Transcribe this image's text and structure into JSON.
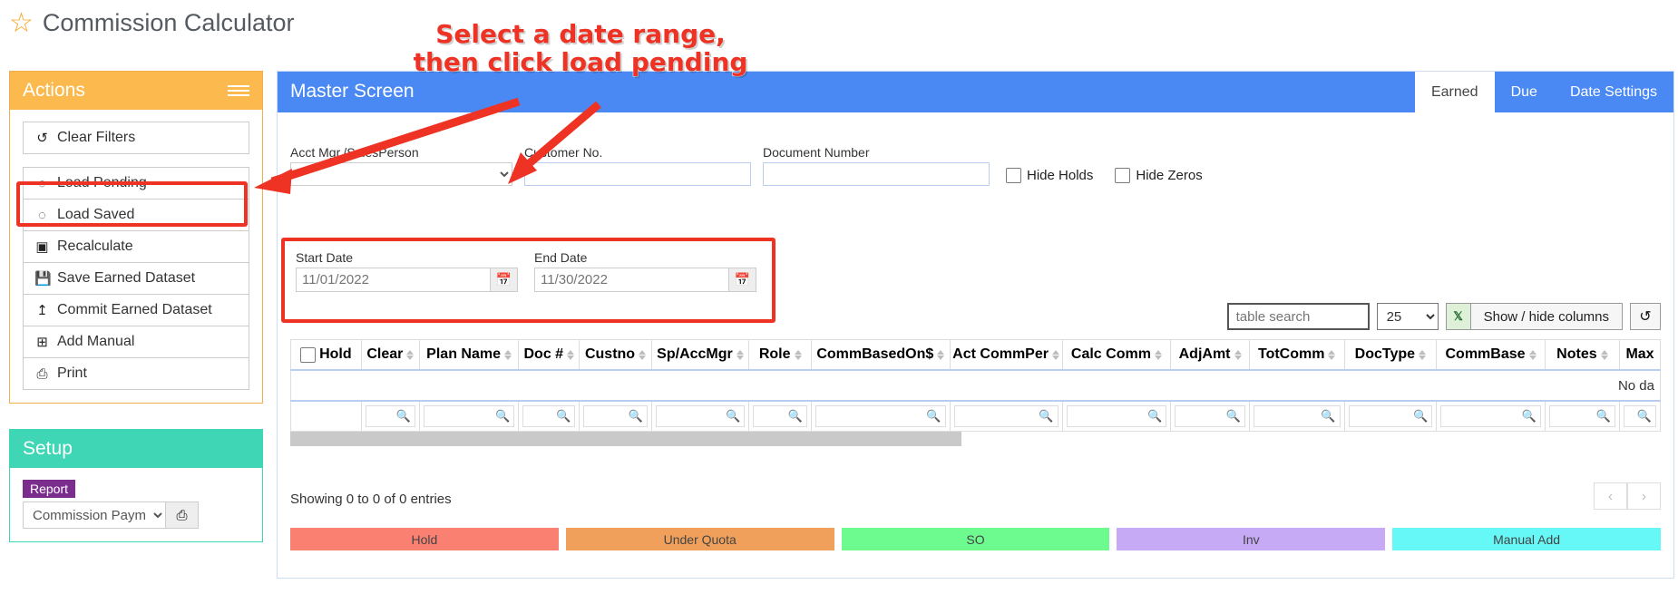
{
  "app": {
    "title": "Commission Calculator",
    "star_icon": "star-icon"
  },
  "annotation": {
    "line1": "Select a date range,",
    "line2": "then click load pending"
  },
  "sidebar": {
    "actions": {
      "title": "Actions",
      "menu_icon": "hamburger-icon",
      "clear_filters": {
        "label": "Clear Filters",
        "icon": "undo-icon"
      },
      "items": [
        {
          "label": "Load Pending",
          "icon": "spinner-icon"
        },
        {
          "label": "Load Saved",
          "icon": "spinner-icon"
        },
        {
          "label": "Recalculate",
          "icon": "book-icon"
        },
        {
          "label": "Save Earned Dataset",
          "icon": "save-icon"
        },
        {
          "label": "Commit Earned Dataset",
          "icon": "upload-icon"
        },
        {
          "label": "Add Manual",
          "icon": "plus-square-icon"
        },
        {
          "label": "Print",
          "icon": "printer-icon"
        }
      ]
    },
    "setup": {
      "title": "Setup",
      "report_badge": "Report",
      "report_selected": "Commission Payments",
      "print_icon": "printer-icon"
    }
  },
  "main": {
    "title": "Master Screen",
    "tabs": [
      {
        "label": "Earned",
        "active": true
      },
      {
        "label": "Due",
        "active": false
      },
      {
        "label": "Date Settings",
        "active": false
      }
    ],
    "filters": {
      "acct_mgr": {
        "label": "Acct Mgr./SalesPerson",
        "value": ""
      },
      "customer_no": {
        "label": "Customer No.",
        "value": "",
        "placeholder": ""
      },
      "document_number": {
        "label": "Document Number",
        "value": "",
        "placeholder": ""
      },
      "hide_holds": {
        "label": "Hide Holds",
        "checked": false
      },
      "hide_zeros": {
        "label": "Hide Zeros",
        "checked": false
      }
    },
    "dates": {
      "start": {
        "label": "Start Date",
        "value": "11/01/2022",
        "icon": "calendar-icon"
      },
      "end": {
        "label": "End Date",
        "value": "11/30/2022",
        "icon": "calendar-icon"
      }
    },
    "table_controls": {
      "search_placeholder": "table search",
      "page_length": "25",
      "excel_icon": "excel-icon",
      "show_hide_columns": "Show / hide columns",
      "reset_icon": "reset-icon"
    },
    "table": {
      "select_all_label": "Hold",
      "columns": [
        "Hold",
        "Clear",
        "Plan Name",
        "Doc #",
        "Custno",
        "Sp/AccMgr",
        "Role",
        "CommBasedOn$",
        "Act CommPer",
        "Calc Comm",
        "AdjAmt",
        "TotComm",
        "DocType",
        "CommBase",
        "Notes",
        "Max"
      ],
      "empty_message": "No da",
      "rows": []
    },
    "footer": {
      "showing": "Showing 0 to 0 of 0 entries",
      "prev_icon": "chevron-left-icon",
      "next_icon": "chevron-right-icon"
    },
    "legend": [
      {
        "label": "Hold",
        "color": "#fa8072"
      },
      {
        "label": "Under Quota",
        "color": "#f0a05a"
      },
      {
        "label": "SO",
        "color": "#6dfa8f"
      },
      {
        "label": "Inv",
        "color": "#c6aaf5"
      },
      {
        "label": "Manual Add",
        "color": "#66f7f7"
      }
    ]
  },
  "colors": {
    "accent_orange": "#fcb94d",
    "accent_teal": "#3ed6b5",
    "accent_blue": "#4a89f3",
    "annotation_red": "#ee3224",
    "badge_purple": "#7b2d8e"
  }
}
